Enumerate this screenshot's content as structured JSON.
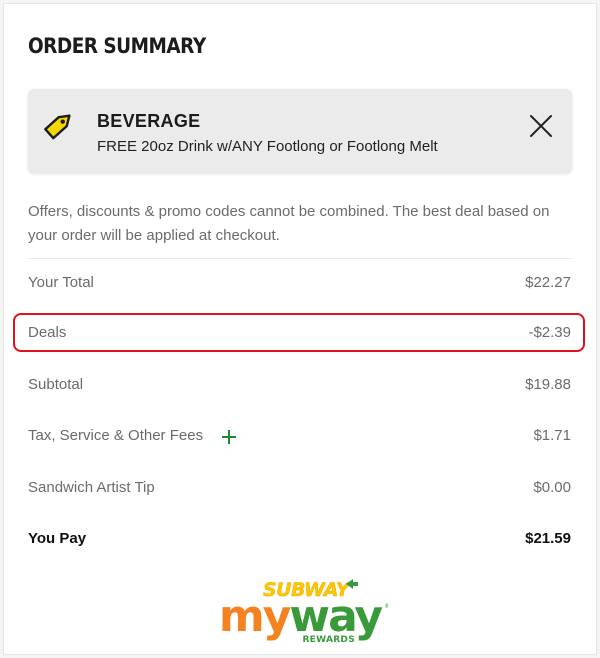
{
  "summary": {
    "title": "ORDER SUMMARY"
  },
  "offer": {
    "icon": "price-tag-icon",
    "icon_color": "#f5d800",
    "title": "BEVERAGE",
    "description": "FREE 20oz Drink w/ANY Footlong or Footlong Melt",
    "close_icon": "close-icon"
  },
  "notice": "Offers, discounts & promo codes cannot be combined. The best deal based on your order will be applied at checkout.",
  "lines": {
    "your_total": {
      "label": "Your Total",
      "value": "$22.27"
    },
    "deals": {
      "label": "Deals",
      "value": "-$2.39",
      "highlight_color": "#e0101f"
    },
    "subtotal": {
      "label": "Subtotal",
      "value": "$19.88"
    },
    "tax": {
      "label": "Tax, Service & Other Fees",
      "value": "$1.71",
      "expand_icon": "plus-icon",
      "icon_color": "#1a8a3a"
    },
    "tip": {
      "label": "Sandwich Artist Tip",
      "value": "$0.00"
    },
    "you_pay": {
      "label": "You Pay",
      "value": "$21.59"
    }
  },
  "logo": {
    "brand": "SUBWAY",
    "product": "myway",
    "sub": "REWARDS",
    "colors": {
      "yellow": "#ffc600",
      "orange": "#f58220",
      "green": "#3a9a3a"
    }
  }
}
